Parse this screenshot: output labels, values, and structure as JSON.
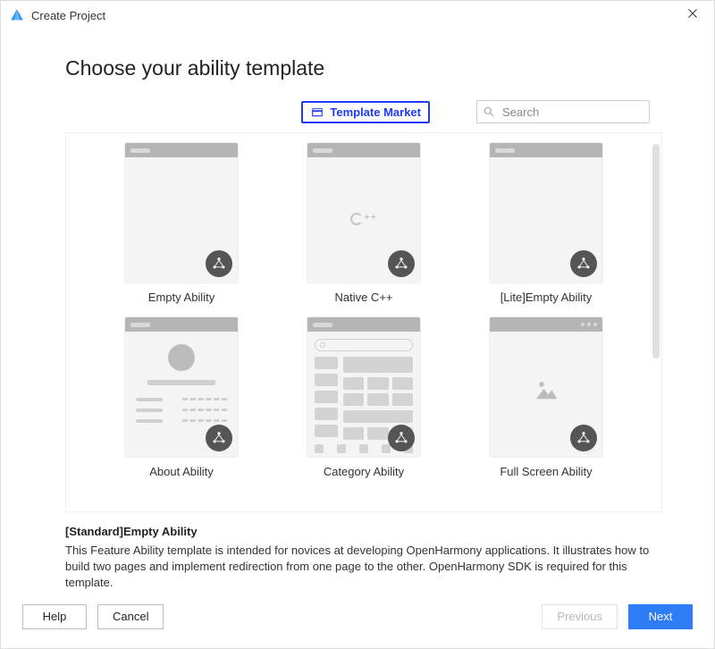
{
  "window": {
    "title": "Create Project"
  },
  "heading": "Choose your ability template",
  "market_button_label": "Template Market",
  "search": {
    "placeholder": "Search"
  },
  "templates": [
    {
      "label": "Empty Ability"
    },
    {
      "label": "Native C++"
    },
    {
      "label": "[Lite]Empty Ability"
    },
    {
      "label": "About Ability"
    },
    {
      "label": "Category Ability"
    },
    {
      "label": "Full Screen Ability"
    }
  ],
  "description": {
    "title": "[Standard]Empty Ability",
    "body": "This Feature Ability template is intended for novices at developing OpenHarmony applications. It illustrates how to build two pages and implement redirection from one page to the other. OpenHarmony SDK is required for this template."
  },
  "footer": {
    "help": "Help",
    "cancel": "Cancel",
    "previous": "Previous",
    "next": "Next"
  }
}
